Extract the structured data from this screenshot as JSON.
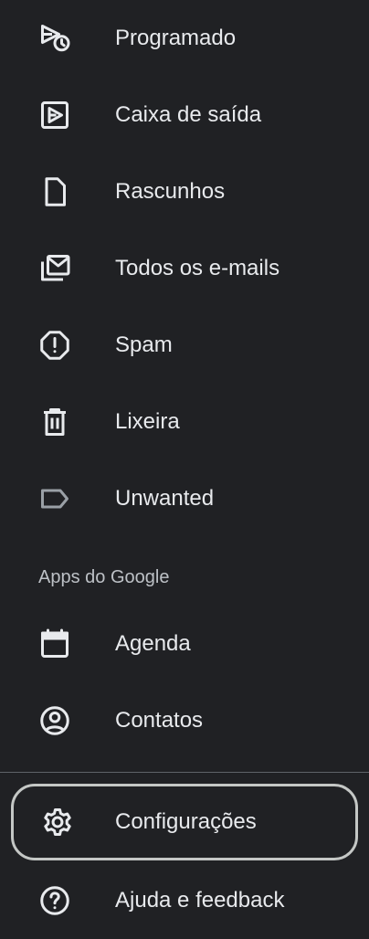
{
  "drawer": {
    "items": [
      {
        "label": "Programado",
        "icon": "scheduled-icon"
      },
      {
        "label": "Caixa de saída",
        "icon": "outbox-icon"
      },
      {
        "label": "Rascunhos",
        "icon": "draft-icon"
      },
      {
        "label": "Todos os e-mails",
        "icon": "all-mail-icon"
      },
      {
        "label": "Spam",
        "icon": "spam-icon"
      },
      {
        "label": "Lixeira",
        "icon": "trash-icon"
      },
      {
        "label": "Unwanted",
        "icon": "label-icon"
      }
    ],
    "google_apps_header": "Apps do Google",
    "google_apps": [
      {
        "label": "Agenda",
        "icon": "calendar-icon"
      },
      {
        "label": "Contatos",
        "icon": "contacts-icon"
      }
    ],
    "footer_items": [
      {
        "label": "Configurações",
        "icon": "settings-icon",
        "focused": true
      },
      {
        "label": "Ajuda e feedback",
        "icon": "help-icon"
      }
    ]
  },
  "colors": {
    "background": "#202124",
    "text": "#e8eaed",
    "section_header": "#bdc1c6",
    "divider": "#5f6368",
    "focus_ring": "#c4c7c5"
  }
}
